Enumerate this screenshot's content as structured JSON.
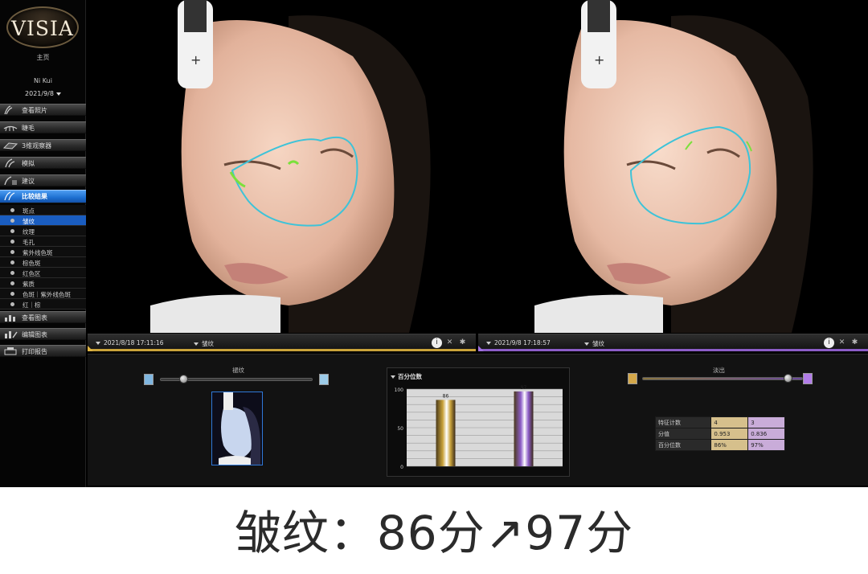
{
  "app": {
    "logo": "VISIA"
  },
  "sidebar": {
    "home": "主页",
    "user": "Ni Kui",
    "date": "2021/9/8",
    "nav_top": [
      {
        "label": "查看照片",
        "icon": "photo-icon"
      },
      {
        "label": "睫毛",
        "icon": "eyelash-icon"
      },
      {
        "label": "3维观察器",
        "icon": "3d-viewer-icon"
      },
      {
        "label": "模拟",
        "icon": "simulation-icon"
      },
      {
        "label": "建议",
        "icon": "suggestion-icon"
      },
      {
        "label": "比较结果",
        "icon": "compare-icon",
        "active": true
      }
    ],
    "sub_items": [
      {
        "label": "斑点"
      },
      {
        "label": "皱纹",
        "active": true
      },
      {
        "label": "纹理"
      },
      {
        "label": "毛孔"
      },
      {
        "label": "紫外线色斑"
      },
      {
        "label": "棕色斑"
      },
      {
        "label": "红色区"
      },
      {
        "label": "紫质"
      },
      {
        "label": "色斑｜紫外线色斑"
      },
      {
        "label": "红｜棕"
      }
    ],
    "nav_bottom": [
      {
        "label": "查看图表",
        "icon": "chart-icon"
      },
      {
        "label": "编辑图表",
        "icon": "edit-chart-icon"
      },
      {
        "label": "打印报告",
        "icon": "print-icon"
      }
    ]
  },
  "left_photo": {
    "date": "2021/8/18 17:11:16",
    "metric": "皱纹",
    "accent": "#c9a23a"
  },
  "right_photo": {
    "date": "2021/9/8 17:18:57",
    "metric": "皱纹",
    "accent": "#8c5dc7"
  },
  "bottom": {
    "left_slider_label": "褪纹",
    "right_slider_label": "淡出",
    "chart_title": "百分位数",
    "stats": [
      {
        "key": "特征计数",
        "v1": "4",
        "v2": "3"
      },
      {
        "key": "分值",
        "v1": "0.953",
        "v2": "0.836"
      },
      {
        "key": "百分位数",
        "v1": "86%",
        "v2": "97%"
      }
    ]
  },
  "chart_data": {
    "type": "bar",
    "title": "百分位数",
    "categories": [
      "2021/8/18",
      "2021/9/8"
    ],
    "values": [
      86,
      97
    ],
    "ylim": [
      0,
      100
    ],
    "yticks": [
      0,
      50,
      100
    ],
    "colors": [
      "#c9a23a",
      "#8c5dc7"
    ],
    "grid": true
  },
  "caption": "皱纹：86分↗97分"
}
